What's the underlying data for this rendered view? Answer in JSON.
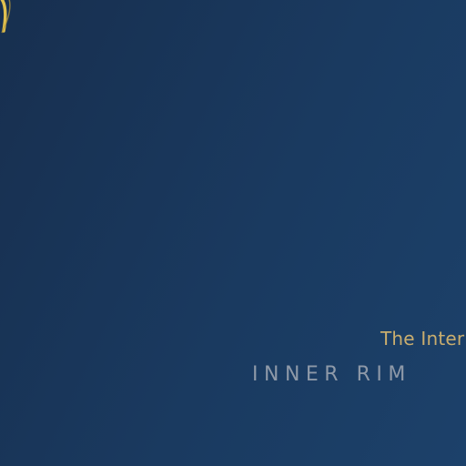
{
  "hero": {
    "tagline": "The Interi",
    "brand": "INNER RIM"
  },
  "colors": {
    "background": "#1a3a60",
    "accent_gold": "#d9b64a",
    "tagline": "#c9ad6e",
    "brand": "#8e99a8"
  },
  "icons": {
    "corner": "gold-arc-icon"
  }
}
